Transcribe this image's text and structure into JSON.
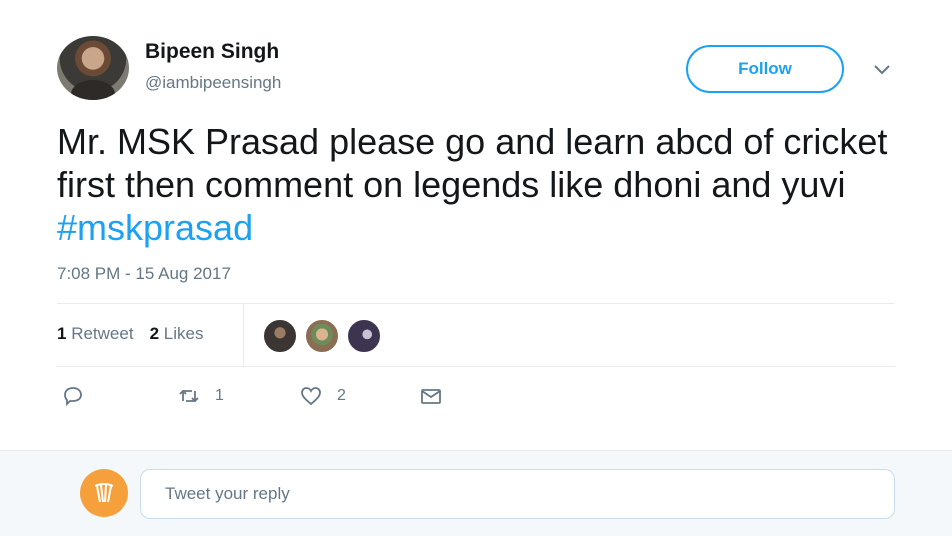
{
  "tweet": {
    "author": {
      "display_name": "Bipeen Singh",
      "handle": "@iambipeensingh"
    },
    "follow_label": "Follow",
    "text_prefix": "Mr. MSK Prasad please go and learn abcd of cricket first then comment on legends like dhoni and yuvi ",
    "hashtag": "#mskprasad",
    "timestamp": "7:08 PM - 15 Aug 2017"
  },
  "stats": {
    "retweet_count": "1",
    "retweet_label": "Retweet",
    "like_count": "2",
    "like_label": "Likes"
  },
  "actions": {
    "reply_count": "",
    "retweet_count": "1",
    "like_count": "2"
  },
  "reply": {
    "placeholder": "Tweet your reply"
  },
  "colors": {
    "accent": "#1da1f2",
    "muted": "#657786",
    "text": "#14171a",
    "reply_avatar": "#f5a03a"
  },
  "icons": {
    "menu": "chevron-down-icon",
    "reply": "reply-icon",
    "retweet": "retweet-icon",
    "like": "heart-icon",
    "message": "envelope-icon",
    "reply_avatar": "cricket-icon"
  }
}
